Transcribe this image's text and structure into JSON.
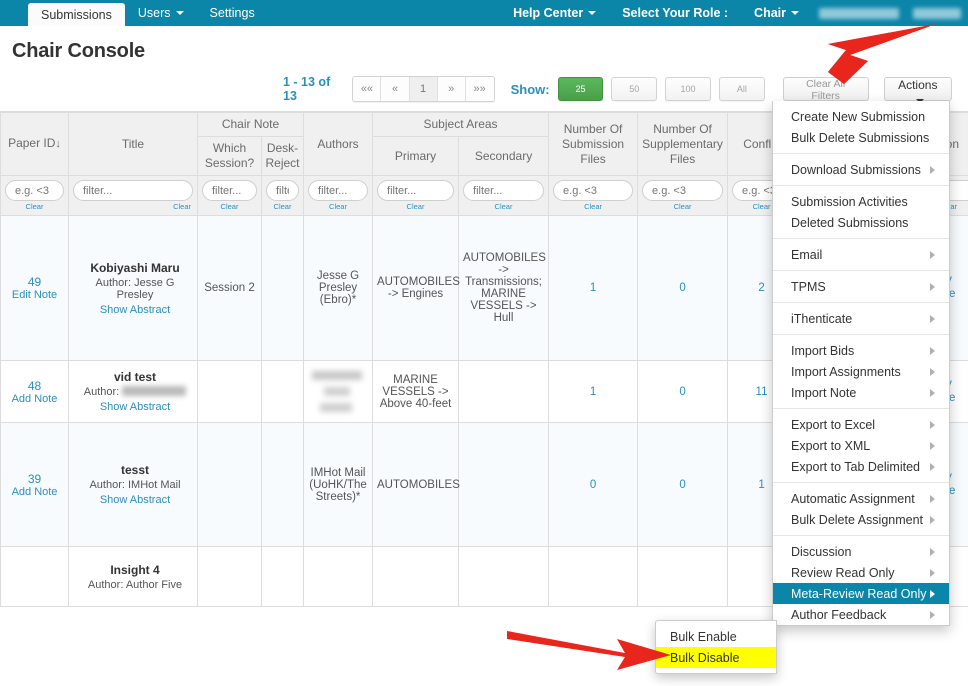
{
  "nav": {
    "left_items": [
      {
        "label": "Submissions",
        "active": true,
        "caret": false
      },
      {
        "label": "Users",
        "active": false,
        "caret": true
      },
      {
        "label": "Settings",
        "active": false,
        "caret": false
      }
    ],
    "help_center": "Help Center",
    "select_role_label": "Select Your Role :",
    "role": "Chair"
  },
  "page": {
    "title": "Chair Console"
  },
  "toolbar": {
    "pager_count": "1 - 13 of 13",
    "pager_buttons": [
      "««",
      "«",
      "1",
      "»",
      "»»"
    ],
    "current_page": "1",
    "show_label": "Show:",
    "page_sizes": [
      "25",
      "50",
      "100",
      "All"
    ],
    "active_page_size": "25",
    "clear_all_filters": "Clear All Filters",
    "actions": "Actions"
  },
  "table": {
    "headers": {
      "paper_id": "Paper ID",
      "sort_arrow": "↓",
      "title": "Title",
      "chair_note": "Chair Note",
      "which_session": "Which Session?",
      "desk_reject": "Desk-Reject",
      "authors": "Authors",
      "subject_areas": "Subject Areas",
      "primary": "Primary",
      "secondary": "Secondary",
      "num_submission_files": "Number Of Submission Files",
      "num_supplementary_files": "Number Of Supplementary Files",
      "conflicts": "Conflic",
      "last_col": "Con"
    },
    "filters": {
      "numeric_placeholder": "e.g. <3",
      "text_placeholder": "filter...",
      "text_placeholder_short": "filter..",
      "clear": "Clear"
    },
    "rows": [
      {
        "id": "49",
        "note_action": "Edit Note",
        "title": "Kobiyashi Maru",
        "author_label": "Author:",
        "author": "Jesse G Presley",
        "author_blurred": false,
        "show_abstract": "Show Abstract",
        "which_session": "Session 2",
        "desk_reject": "",
        "authors": "Jesse G Presley (Ebro)*",
        "authors_blurred": false,
        "primary": "AUTOMOBILES -> Engines",
        "secondary": "AUTOMOBILES -> Transmissions; MARINE VESSELS -> Hull",
        "num_submission_files": "1",
        "num_supplementary_files": "0",
        "conflicts": "2",
        "tail_link_top": "V",
        "tail_link_bottom": "Re"
      },
      {
        "id": "48",
        "note_action": "Add Note",
        "title": "vid test",
        "author_label": "Author:",
        "author": "",
        "author_blurred": true,
        "show_abstract": "Show Abstract",
        "which_session": "",
        "desk_reject": "",
        "authors": "",
        "authors_blurred": true,
        "primary": "MARINE VESSELS -> Above 40-feet",
        "secondary": "",
        "num_submission_files": "1",
        "num_supplementary_files": "0",
        "conflicts": "11",
        "tail_link_top": "V",
        "tail_link_bottom": "Re"
      },
      {
        "id": "39",
        "note_action": "Add Note",
        "title": "tesst",
        "author_label": "Author:",
        "author": "IMHot Mail",
        "author_blurred": false,
        "show_abstract": "Show Abstract",
        "which_session": "",
        "desk_reject": "",
        "authors": "IMHot Mail (UoHK/The Streets)*",
        "authors_blurred": false,
        "primary": "AUTOMOBILES",
        "secondary": "",
        "num_submission_files": "0",
        "num_supplementary_files": "0",
        "conflicts": "1",
        "tail_link_top": "V",
        "tail_link_bottom": "Re"
      },
      {
        "id": "",
        "note_action": "",
        "title": "Insight 4",
        "author_label": "Author:",
        "author": "Author Five",
        "author_blurred": false,
        "show_abstract": "",
        "which_session": "",
        "desk_reject": "",
        "authors": "",
        "authors_blurred": false,
        "primary": "",
        "secondary": "",
        "num_submission_files": "",
        "num_supplementary_files": "",
        "conflicts": "",
        "tail_link_top": "",
        "tail_link_bottom": ""
      }
    ]
  },
  "actions_menu": {
    "groups": [
      {
        "items": [
          {
            "label": "Create New Submission",
            "arrow": false,
            "selected": false
          },
          {
            "label": "Bulk Delete Submissions",
            "arrow": false,
            "selected": false
          }
        ]
      },
      {
        "items": [
          {
            "label": "Download Submissions",
            "arrow": true,
            "selected": false
          }
        ]
      },
      {
        "items": [
          {
            "label": "Submission Activities",
            "arrow": false,
            "selected": false
          },
          {
            "label": "Deleted Submissions",
            "arrow": false,
            "selected": false
          }
        ]
      },
      {
        "items": [
          {
            "label": "Email",
            "arrow": true,
            "selected": false
          }
        ]
      },
      {
        "items": [
          {
            "label": "TPMS",
            "arrow": true,
            "selected": false
          }
        ]
      },
      {
        "items": [
          {
            "label": "iThenticate",
            "arrow": true,
            "selected": false
          }
        ]
      },
      {
        "items": [
          {
            "label": "Import Bids",
            "arrow": true,
            "selected": false
          },
          {
            "label": "Import Assignments",
            "arrow": true,
            "selected": false
          },
          {
            "label": "Import Note",
            "arrow": true,
            "selected": false
          }
        ]
      },
      {
        "items": [
          {
            "label": "Export to Excel",
            "arrow": true,
            "selected": false
          },
          {
            "label": "Export to XML",
            "arrow": true,
            "selected": false
          },
          {
            "label": "Export to Tab Delimited",
            "arrow": true,
            "selected": false
          }
        ]
      },
      {
        "items": [
          {
            "label": "Automatic Assignment",
            "arrow": true,
            "selected": false
          },
          {
            "label": "Bulk Delete Assignment",
            "arrow": true,
            "selected": false
          }
        ]
      },
      {
        "items": [
          {
            "label": "Discussion",
            "arrow": true,
            "selected": false
          },
          {
            "label": "Review Read Only",
            "arrow": true,
            "selected": false
          },
          {
            "label": "Meta-Review Read Only",
            "arrow": true,
            "selected": true
          },
          {
            "label": "Author Feedback",
            "arrow": true,
            "selected": false
          }
        ]
      }
    ]
  },
  "submenu": {
    "items": [
      {
        "label": "Bulk Enable",
        "highlighted": false
      },
      {
        "label": "Bulk Disable",
        "highlighted": true
      }
    ]
  },
  "colors": {
    "brand": "#0b86a8",
    "link": "#2b8fbd",
    "green": "#5cb85c",
    "highlight": "#ffff00",
    "annotation_arrow": "#e8261c"
  }
}
